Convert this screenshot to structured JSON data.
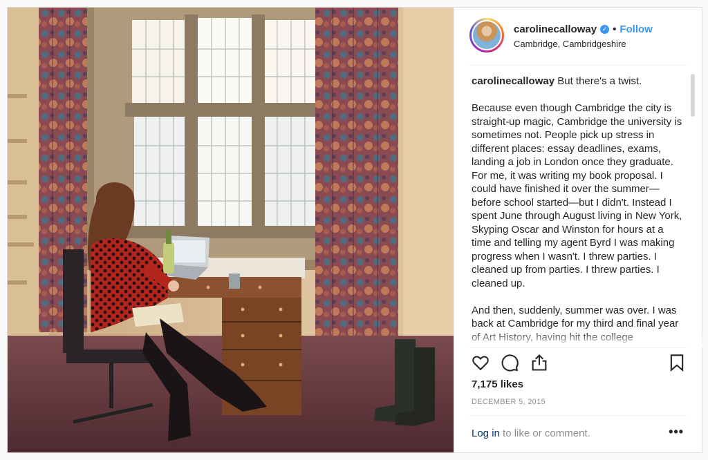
{
  "post": {
    "photo_alt": "Photo by carolinecalloway"
  },
  "header": {
    "username": "carolinecalloway",
    "verified_icon": "verified-badge-icon",
    "separator": "•",
    "follow_label": "Follow",
    "location": "Cambridge, Cambridgeshire"
  },
  "caption": {
    "username": "carolinecalloway",
    "first_line": " But there's a twist.",
    "paragraph_1": "Because even though Cambridge the city is straight-up magic, Cambridge the university is sometimes not. People pick up stress in different places: essay deadlines, exams, landing a job in London once they graduate. For me, it was writing my book proposal. I could have finished it over the summer—before school started—but I didn't. Instead I spent June through August living in New York, Skyping Oscar and Winston for hours at a time and telling my agent Byrd I was making progress when I wasn't. I threw parties. I cleaned up from parties. I threw parties. I cleaned up.",
    "paragraph_2": "And then, suddenly, summer was over. I was back at Cambridge for my third and final year of Art History, having hit the college"
  },
  "actions": {
    "like_icon": "heart-icon",
    "comment_icon": "comment-icon",
    "share_icon": "share-icon",
    "save_icon": "bookmark-icon"
  },
  "likes": "7,175 likes",
  "date": "DECEMBER 5, 2015",
  "footer": {
    "login_label": "Log in",
    "prompt": " to like or comment.",
    "more_label": "•••"
  },
  "colors": {
    "accent": "#3897f0",
    "muted": "#8e8e8e",
    "text": "#262626"
  }
}
